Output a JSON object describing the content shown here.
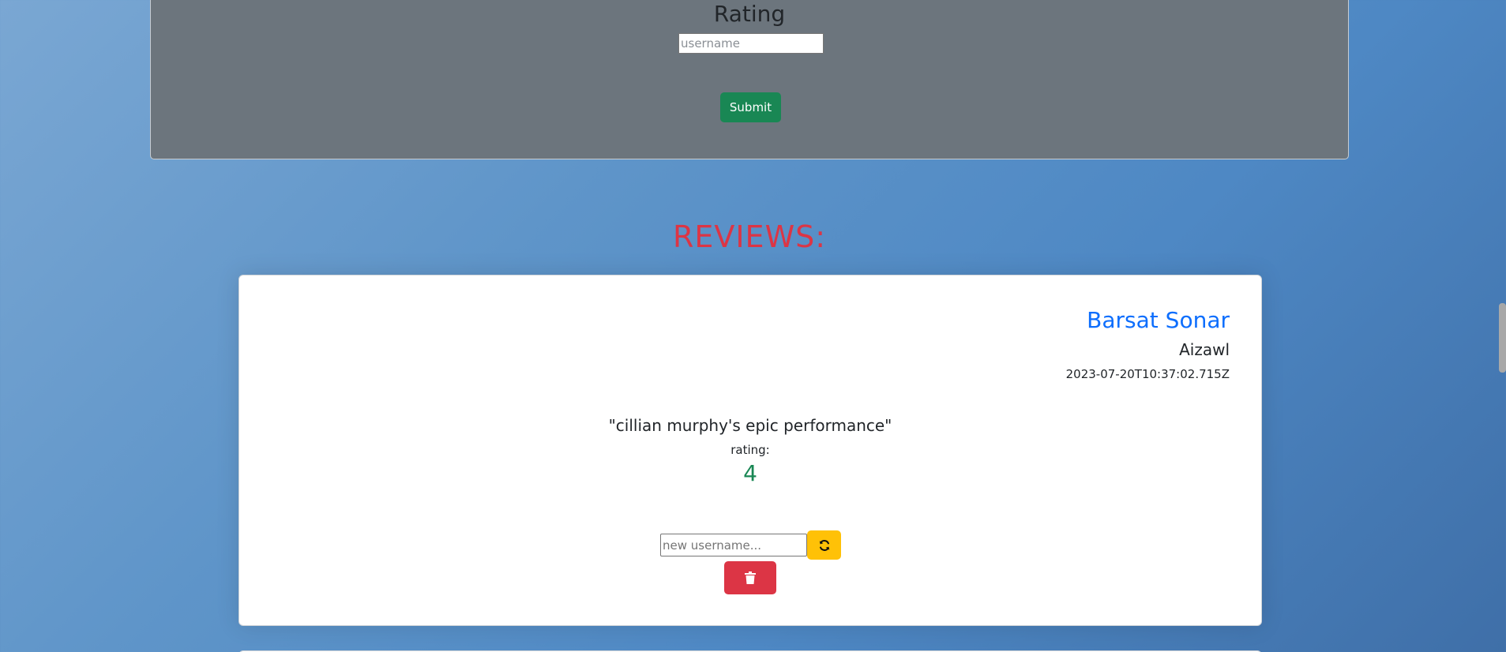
{
  "form": {
    "title": "Rating",
    "username_placeholder": "username",
    "submit_label": "Submit"
  },
  "reviews": {
    "heading": "REVIEWS:",
    "items": [
      {
        "name": "Barsat Sonar",
        "city": "Aizawl",
        "date": "2023-07-20T10:37:02.715Z",
        "text": "\"cillian murphy's epic performance\"",
        "rating_label": "rating:",
        "rating": "4",
        "new_username_placeholder": "new username..."
      }
    ]
  },
  "icons": {
    "update": "sync-icon",
    "delete": "trash-icon"
  },
  "colors": {
    "page_background": "#5f95c9",
    "form_card": "#6c757d",
    "submit": "#198754",
    "heading": "#dc3545",
    "name": "#0d6efd",
    "rating": "#198754",
    "update_button": "#ffc107",
    "delete_button": "#dc3545"
  }
}
